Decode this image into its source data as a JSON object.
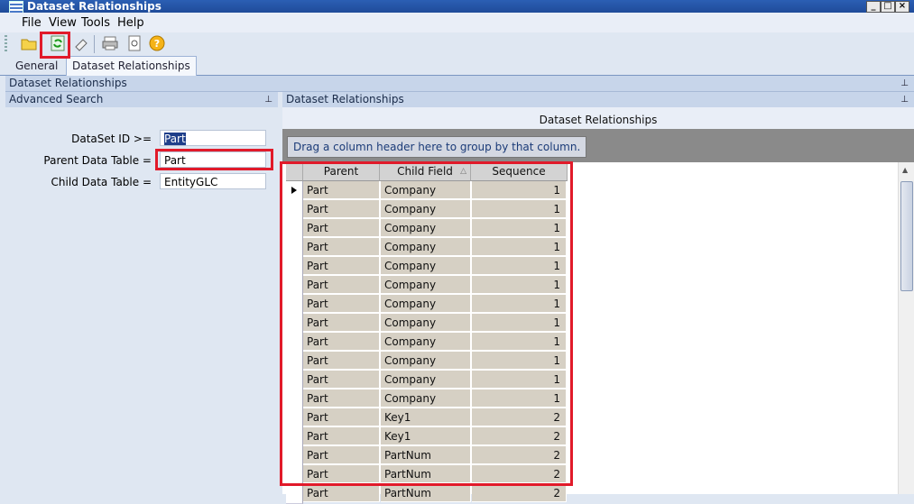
{
  "window": {
    "title": "Dataset Relationships"
  },
  "menu": [
    "File",
    "View",
    "Tools",
    "Help"
  ],
  "toolbar": {
    "icons": [
      "open-folder-icon",
      "refresh-icon",
      "clear-icon",
      "print-icon",
      "print-preview-icon",
      "help-icon"
    ]
  },
  "tabs": {
    "general": "General",
    "dataset_relationships": "Dataset Relationships"
  },
  "panel": {
    "header": "Dataset Relationships"
  },
  "search": {
    "header": "Advanced Search",
    "fields": [
      {
        "label": "DataSet ID >=",
        "value": "Part"
      },
      {
        "label": "Parent Data Table =",
        "value": "Part"
      },
      {
        "label": "Child Data Table =",
        "value": "EntityGLC"
      }
    ]
  },
  "grid": {
    "header": "Dataset Relationships",
    "title": "Dataset Relationships",
    "group_hint": "Drag a column header here to group by that column.",
    "columns": [
      "Parent",
      "Child Field",
      "Sequence"
    ],
    "rows": [
      [
        "Part",
        "Company",
        "1"
      ],
      [
        "Part",
        "Company",
        "1"
      ],
      [
        "Part",
        "Company",
        "1"
      ],
      [
        "Part",
        "Company",
        "1"
      ],
      [
        "Part",
        "Company",
        "1"
      ],
      [
        "Part",
        "Company",
        "1"
      ],
      [
        "Part",
        "Company",
        "1"
      ],
      [
        "Part",
        "Company",
        "1"
      ],
      [
        "Part",
        "Company",
        "1"
      ],
      [
        "Part",
        "Company",
        "1"
      ],
      [
        "Part",
        "Company",
        "1"
      ],
      [
        "Part",
        "Company",
        "1"
      ],
      [
        "Part",
        "Key1",
        "2"
      ],
      [
        "Part",
        "Key1",
        "2"
      ],
      [
        "Part",
        "PartNum",
        "2"
      ],
      [
        "Part",
        "PartNum",
        "2"
      ],
      [
        "Part",
        "PartNum",
        "2"
      ]
    ]
  },
  "colors": {
    "highlight": "#e11a2a",
    "row_bg": "#d6d0c4",
    "title_bar": "#1f4b99"
  }
}
